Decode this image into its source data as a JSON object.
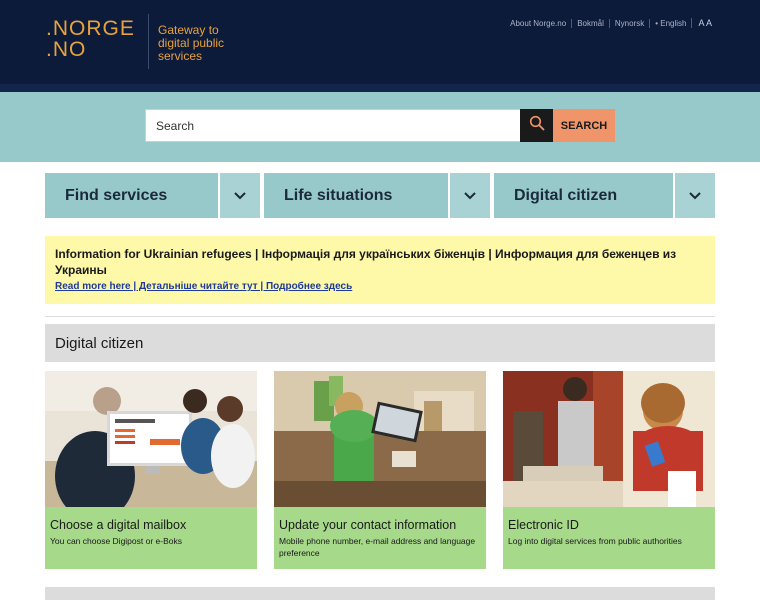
{
  "header": {
    "logo_line1": ".NORGE",
    "logo_line2": ".NO",
    "tagline": "Gateway to digital public services",
    "nav": [
      {
        "label": "About Norge.no"
      },
      {
        "label": "Bokmål"
      },
      {
        "label": "Nynorsk"
      },
      {
        "label": "• English"
      }
    ],
    "font_size_label": "A A"
  },
  "search": {
    "placeholder": "Search",
    "button_label": "SEARCH"
  },
  "navtabs": [
    {
      "label": "Find services"
    },
    {
      "label": "Life situations"
    },
    {
      "label": "Digital citizen"
    }
  ],
  "notice": {
    "title": "Information for Ukrainian refugees | Інформація для українських біженців | Информация для беженцев из Украины",
    "link": "Read more here | Детальніше читайте тут | Подробнее здесь"
  },
  "section": {
    "title": "Digital citizen"
  },
  "cards": [
    {
      "title": "Choose a digital mailbox",
      "desc": "You can choose Digipost or e-Boks"
    },
    {
      "title": "Update your contact information",
      "desc": "Mobile phone number, e-mail address and language preference"
    },
    {
      "title": "Electronic ID",
      "desc": "Log into digital services from public authorities"
    }
  ],
  "colors": {
    "header_bg": "#0d1b3b",
    "brand_orange": "#e8a23c",
    "teal": "#97c8ca",
    "search_button": "#f0956a",
    "notice_bg": "#fef9a8",
    "card_green": "#a6d98a"
  }
}
